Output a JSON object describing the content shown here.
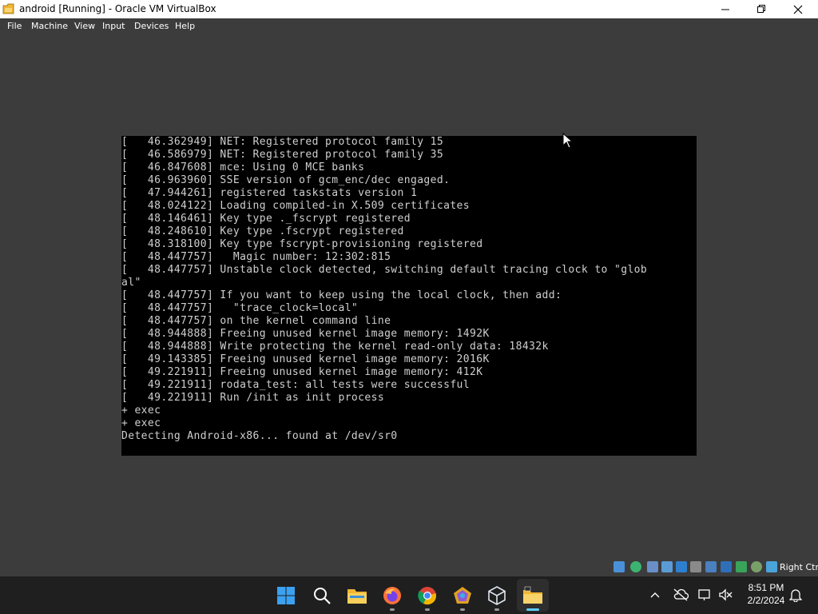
{
  "window": {
    "title": "android [Running] - Oracle VM VirtualBox",
    "minimize_symbol": "—",
    "maximize_symbol": "❐",
    "close_symbol": "✕"
  },
  "menu": {
    "items": [
      "File",
      "Machine",
      "View",
      "Input",
      "Devices",
      "Help"
    ]
  },
  "console": {
    "lines": [
      "[   46.362949] NET: Registered protocol family 15",
      "[   46.586979] NET: Registered protocol family 35",
      "[   46.847608] mce: Using 0 MCE banks",
      "[   46.963960] SSE version of gcm_enc/dec engaged.",
      "[   47.944261] registered taskstats version 1",
      "[   48.024122] Loading compiled-in X.509 certificates",
      "[   48.146461] Key type ._fscrypt registered",
      "[   48.248610] Key type .fscrypt registered",
      "[   48.318100] Key type fscrypt-provisioning registered",
      "[   48.447757]   Magic number: 12:302:815",
      "[   48.447757] Unstable clock detected, switching default tracing clock to \"glob",
      "al\"",
      "[   48.447757] If you want to keep using the local clock, then add:",
      "[   48.447757]   \"trace_clock=local\"",
      "[   48.447757] on the kernel command line",
      "[   48.944888] Freeing unused kernel image memory: 1492K",
      "[   48.944888] Write protecting the kernel read-only data: 18432k",
      "[   49.143385] Freeing unused kernel image memory: 2016K",
      "[   49.221911] Freeing unused kernel image memory: 412K",
      "[   49.221911] rodata_test: all tests were successful",
      "[   49.221911] Run /init as init process",
      "+ exec",
      "+ exec",
      "Detecting Android-x86... found at /dev/sr0"
    ]
  },
  "statusbar": {
    "icons": [
      "hard-disk-icon",
      "optical-drive-icon",
      "audio-icon",
      "network-icon",
      "usb-icon",
      "shared-folders-icon",
      "display-icon",
      "recording-icon",
      "drag-drop-icon",
      "clipboard-icon",
      "cpu-icon",
      "mouse-integration-icon"
    ],
    "host_key": "Right Ctrl"
  },
  "taskbar": {
    "apps": [
      "start-icon",
      "search-icon",
      "file-explorer-icon",
      "firefox-icon",
      "chrome-icon",
      "app-icon",
      "virtualbox-icon",
      "virtualbox-vm-icon"
    ],
    "tray": {
      "chevron": "^",
      "clock_time": "8:51 PM",
      "clock_date": "2/2/2024"
    }
  }
}
